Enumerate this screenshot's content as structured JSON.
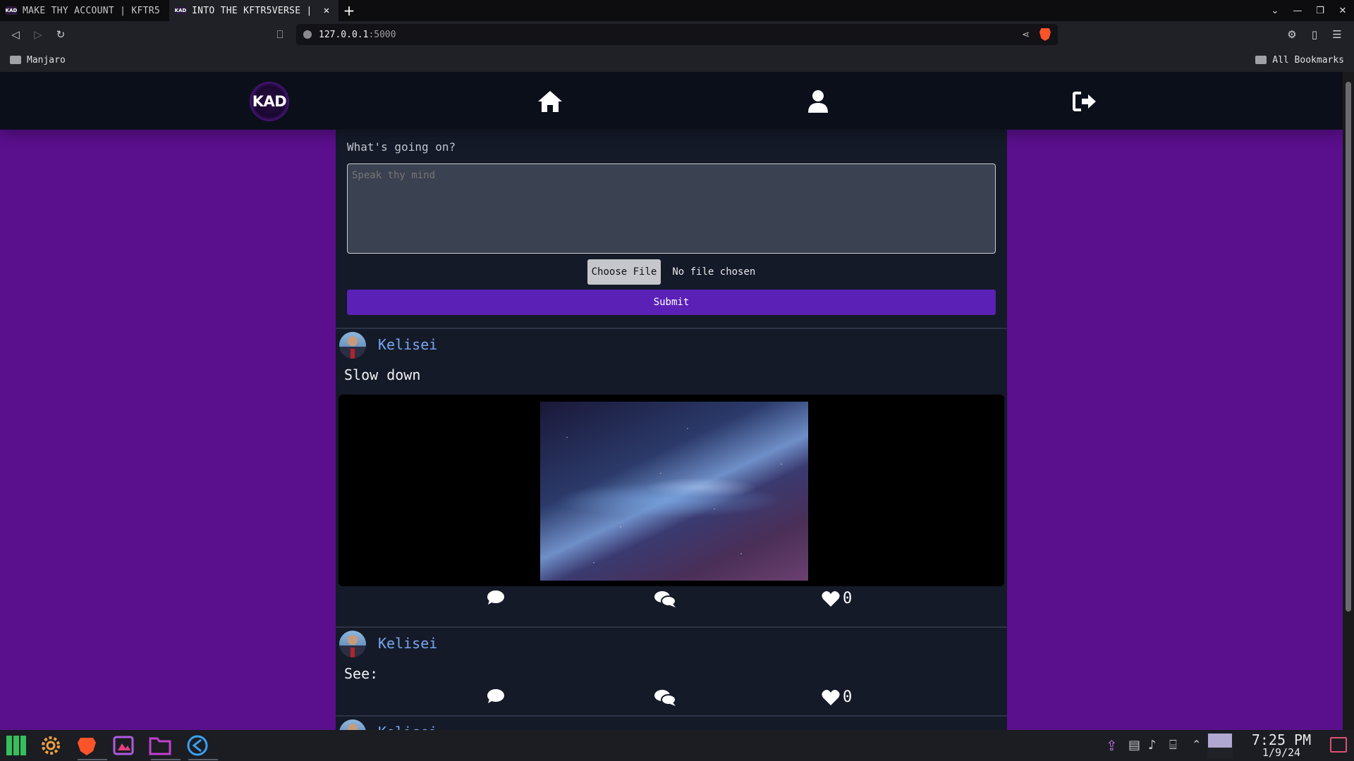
{
  "browser": {
    "tabs": [
      {
        "favicon": "KAD",
        "title": "MAKE THY ACCOUNT | KFTR5",
        "active": false
      },
      {
        "favicon": "KAD",
        "title": "INTO THE KFTR5VERSE |",
        "active": true
      }
    ],
    "new_tab_label": "+",
    "url_host": "127.0.0.1",
    "url_port": ":5000",
    "bookmarks": [
      {
        "label": "Manjaro"
      }
    ],
    "all_bookmarks_label": "All Bookmarks"
  },
  "site": {
    "logo_text": "KAD",
    "compose": {
      "label": "What's going on?",
      "placeholder": "Speak thy mind",
      "choose_file_label": "Choose File",
      "no_file_label": "No file chosen",
      "submit_label": "Submit"
    },
    "posts": [
      {
        "username": "Kelisei",
        "text": "Slow down",
        "has_image": true,
        "likes": "0"
      },
      {
        "username": "Kelisei",
        "text": "See:",
        "has_image": false,
        "likes": "0"
      },
      {
        "username": "Kelisei",
        "text": "",
        "has_image": false,
        "likes": ""
      }
    ]
  },
  "taskbar": {
    "time": "7:25 PM",
    "date": "1/9/24",
    "apps": [
      "manjaro-menu",
      "settings",
      "brave-browser",
      "image-editor",
      "file-manager",
      "vscode"
    ]
  },
  "colors": {
    "page_background": "#5a0f8c",
    "feed_background": "#141a28",
    "submit_button": "#5b21b6",
    "username": "#7aa7f0"
  }
}
